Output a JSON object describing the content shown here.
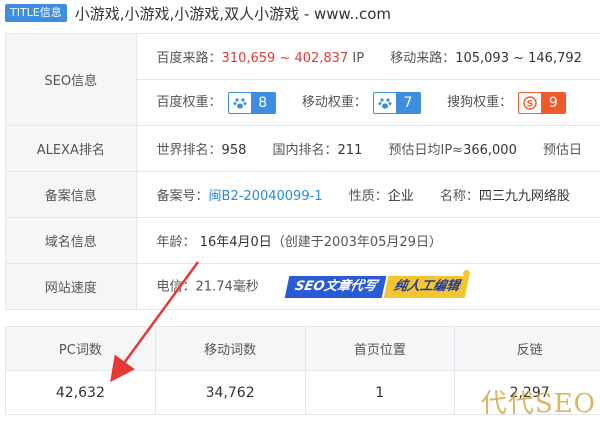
{
  "title": {
    "badge": "TITLE信息",
    "text": "小游戏,小游戏,小游戏,双人小游戏 - www..com"
  },
  "seo": {
    "label": "SEO信息",
    "baidu_traffic_label": "百度来路：",
    "baidu_traffic_value": "310,659 ~ 402,837",
    "baidu_traffic_unit": "IP",
    "mobile_traffic_label": "移动来路：",
    "mobile_traffic_value": "105,093 ~ 146,792",
    "baidu_weight_label": "百度权重：",
    "baidu_weight_value": "8",
    "mobile_weight_label": "移动权重：",
    "mobile_weight_value": "7",
    "sogou_weight_label": "搜狗权重：",
    "sogou_weight_value": "9"
  },
  "alexa": {
    "label": "ALEXA排名",
    "world_label": "世界排名：",
    "world_value": "958",
    "domestic_label": "国内排名：",
    "domestic_value": "211",
    "daily_ip_label": "预估日均IP≈",
    "daily_ip_value": "366,000",
    "daily_pv_label": "预估日"
  },
  "icp": {
    "label": "备案信息",
    "number_label": "备案号：",
    "number_value": "闽B2-20040099-1",
    "nature_label": "性质：",
    "nature_value": "企业",
    "name_label": "名称：",
    "name_value": "四三九九网络股"
  },
  "domain": {
    "label": "域名信息",
    "age_label": "年龄：",
    "age_value": "16年4月0日",
    "created": "（创建于2003年05月29日）"
  },
  "speed": {
    "label": "网站速度",
    "telecom": "电信：21.74毫秒",
    "banner_left": "SEO文章代写",
    "banner_right": "纯人工编辑"
  },
  "stats": {
    "headers": [
      "PC词数",
      "移动词数",
      "首页位置",
      "反链"
    ],
    "values": [
      "42,632",
      "34,762",
      "1",
      "2,297"
    ]
  },
  "watermark": "代代SEO",
  "colors": {
    "accent_blue": "#3d8ee0",
    "sogou_orange": "#f05a28",
    "arrow_red": "#e53935"
  }
}
